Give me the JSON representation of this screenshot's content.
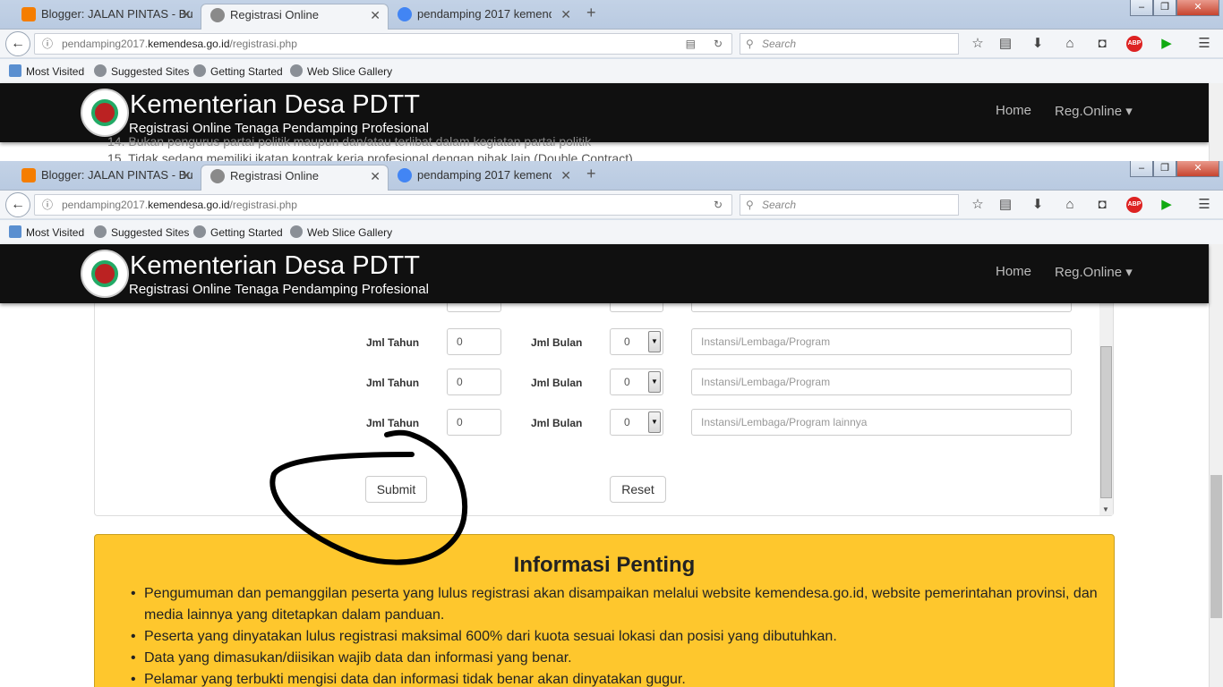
{
  "browser": {
    "tabs": [
      {
        "label": "Blogger: JALAN PINTAS - Bu",
        "active": false,
        "favicon_color": "#f57d00"
      },
      {
        "label": "Registrasi Online",
        "active": true,
        "favicon_color": "#8a8a8a"
      },
      {
        "label": "pendamping 2017 kemendes",
        "active": false,
        "favicon_color": "#4285f4"
      }
    ],
    "new_tab": "+",
    "window_controls": [
      "–",
      "❐",
      "✕"
    ],
    "url_prefix": "pendamping2017.",
    "url_domain": "kemendesa.go.id",
    "url_path": "/registrasi.php",
    "search_placeholder": "Search",
    "bookmarks": [
      "Most Visited",
      "Suggested Sites",
      "Getting Started",
      "Web Slice Gallery"
    ]
  },
  "site": {
    "title": "Kementerian Desa PDTT",
    "subtitle": "Registrasi Online Tenaga Pendamping Profesional",
    "nav": [
      "Home",
      "Reg.Online ▾"
    ]
  },
  "background_text": {
    "line1": "14. Bukan pengurus partai politik maupun dan/atau terlibat dalam kegiatan partai politik",
    "line2": "15. Tidak sedang memiliki ikatan kontrak kerja profesional dengan pihak lain (Double Contract)"
  },
  "form": {
    "rows": [
      {
        "tahun_label": "Jml Tahun",
        "tahun_value": "0",
        "bulan_label": "Jml Bulan",
        "bulan_value": "0",
        "instansi_placeholder": "Instansi/Lembaga/Program"
      },
      {
        "tahun_label": "Jml Tahun",
        "tahun_value": "0",
        "bulan_label": "Jml Bulan",
        "bulan_value": "0",
        "instansi_placeholder": "Instansi/Lembaga/Program"
      },
      {
        "tahun_label": "Jml Tahun",
        "tahun_value": "0",
        "bulan_label": "Jml Bulan",
        "bulan_value": "0",
        "instansi_placeholder": "Instansi/Lembaga/Program lainnya"
      }
    ],
    "submit_label": "Submit",
    "reset_label": "Reset"
  },
  "info": {
    "title": "Informasi Penting",
    "items": [
      "Pengumuman dan pemanggilan peserta yang lulus registrasi akan disampaikan melalui website kemendesa.go.id, website pemerintahan provinsi, dan media lainnya yang ditetapkan dalam panduan.",
      "Peserta yang dinyatakan lulus registrasi maksimal 600% dari kuota sesuai lokasi dan posisi yang dibutuhkan.",
      "Data yang dimasukan/diisikan wajib data dan informasi yang benar.",
      "Pelamar yang terbukti mengisi data dan informasi tidak benar akan dinyatakan gugur."
    ]
  },
  "colors": {
    "info_bg": "#fec72d",
    "header_bg": "#101010",
    "annotation": "#000000"
  }
}
